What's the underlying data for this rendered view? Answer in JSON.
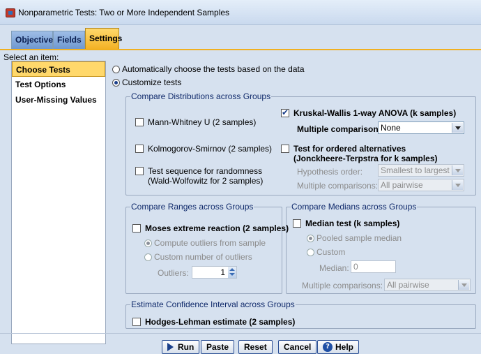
{
  "window": {
    "title": "Nonparametric Tests: Two or More Independent Samples"
  },
  "tabs": [
    {
      "label": "Objective"
    },
    {
      "label": "Fields"
    },
    {
      "label": "Settings"
    }
  ],
  "sidebar": {
    "label": "Select an item:",
    "items": [
      {
        "label": "Choose Tests"
      },
      {
        "label": "Test Options"
      },
      {
        "label": "User-Missing Values"
      }
    ]
  },
  "mode": {
    "auto_label": "Automatically choose the tests based on the data",
    "custom_label": "Customize tests"
  },
  "distributions": {
    "title": "Compare Distributions across Groups",
    "mann_whitney": "Mann-Whitney U (2 samples)",
    "kolmogorov": "Kolmogorov-Smirnov (2 samples)",
    "runs_line1": "Test sequence for randomness",
    "runs_line2": "(Wald-Wolfowitz for 2 samples)",
    "kruskal": "Kruskal-Wallis 1-way ANOVA (k samples)",
    "multiple_label": "Multiple comparisons:",
    "multiple_value": "None",
    "jt_line1": "Test for ordered alternatives",
    "jt_line2": "(Jonckheere-Terpstra for k samples)",
    "hyp_order_label": "Hypothesis order:",
    "hyp_order_value": "Smallest to largest",
    "jt_multiple_label": "Multiple comparisons:",
    "jt_multiple_value": "All pairwise"
  },
  "ranges": {
    "title": "Compare Ranges across Groups",
    "moses": "Moses extreme reaction (2 samples)",
    "compute_outliers": "Compute outliers from sample",
    "custom_outliers": "Custom number of outliers",
    "outliers_label": "Outliers:",
    "outliers_value": "1"
  },
  "medians": {
    "title": "Compare Medians across Groups",
    "median_test": "Median test (k samples)",
    "pooled": "Pooled sample median",
    "custom": "Custom",
    "median_label": "Median:",
    "median_value": "0",
    "multiple_label": "Multiple comparisons:",
    "multiple_value": "All pairwise"
  },
  "ci": {
    "title": "Estimate Confidence Interval across Groups",
    "hodges": "Hodges-Lehman estimate (2 samples)"
  },
  "buttons": {
    "run": "Run",
    "paste": "Paste",
    "reset": "Reset",
    "cancel": "Cancel",
    "help": "Help"
  }
}
